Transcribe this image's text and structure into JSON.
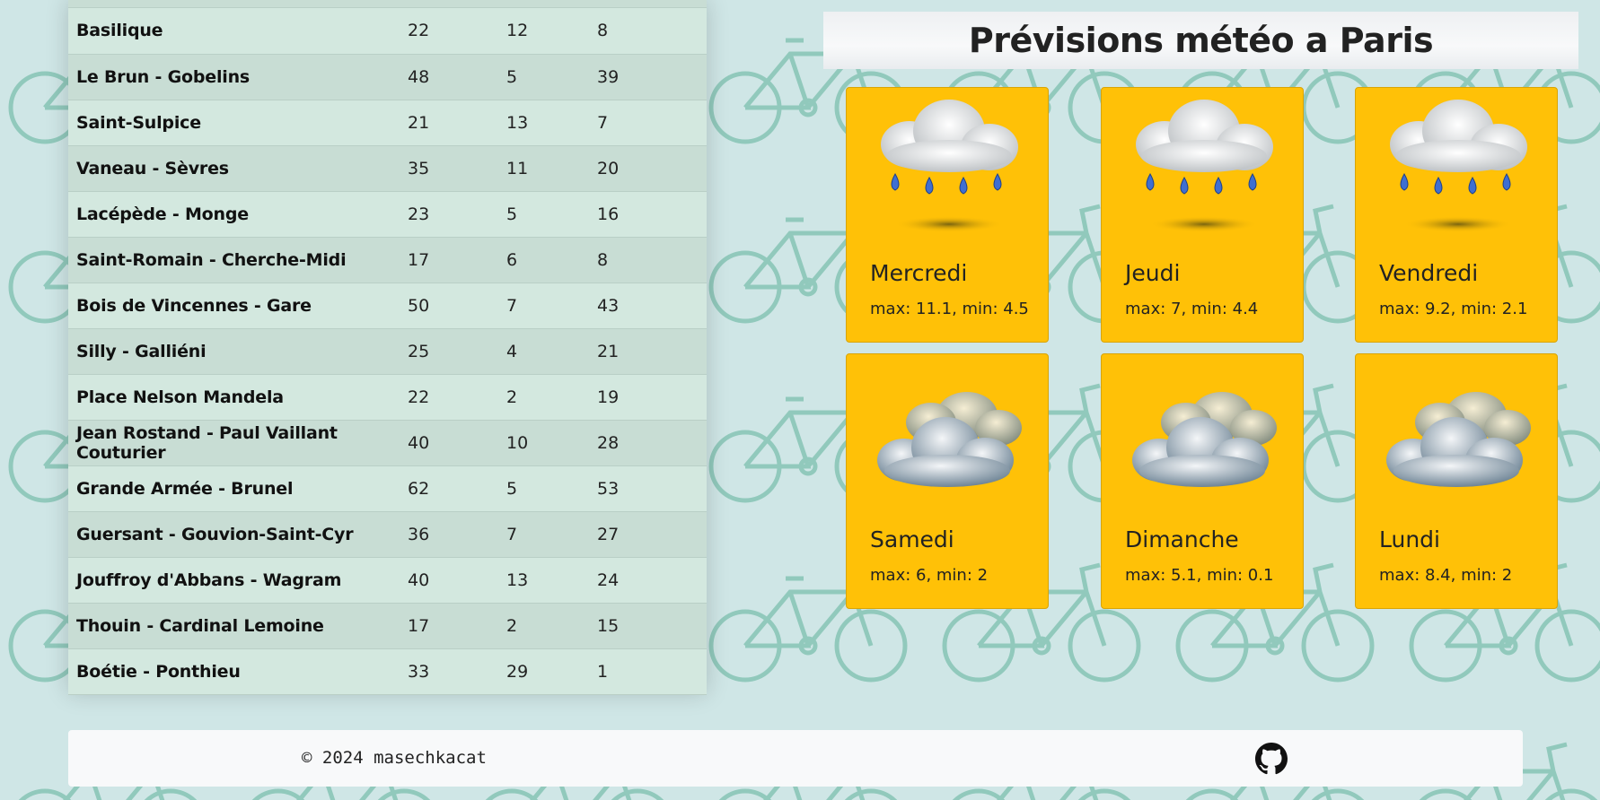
{
  "stations": {
    "rows": [
      {
        "name": "Basilique",
        "c1": "22",
        "c2": "12",
        "c3": "8"
      },
      {
        "name": "Le Brun - Gobelins",
        "c1": "48",
        "c2": "5",
        "c3": "39"
      },
      {
        "name": "Saint-Sulpice",
        "c1": "21",
        "c2": "13",
        "c3": "7"
      },
      {
        "name": "Vaneau - Sèvres",
        "c1": "35",
        "c2": "11",
        "c3": "20"
      },
      {
        "name": "Lacépède - Monge",
        "c1": "23",
        "c2": "5",
        "c3": "16"
      },
      {
        "name": "Saint-Romain - Cherche-Midi",
        "c1": "17",
        "c2": "6",
        "c3": "8"
      },
      {
        "name": "Bois de Vincennes - Gare",
        "c1": "50",
        "c2": "7",
        "c3": "43"
      },
      {
        "name": "Silly - Galliéni",
        "c1": "25",
        "c2": "4",
        "c3": "21"
      },
      {
        "name": "Place Nelson Mandela",
        "c1": "22",
        "c2": "2",
        "c3": "19"
      },
      {
        "name": "Jean Rostand - Paul Vaillant Couturier",
        "c1": "40",
        "c2": "10",
        "c3": "28"
      },
      {
        "name": "Grande Armée - Brunel",
        "c1": "62",
        "c2": "5",
        "c3": "53"
      },
      {
        "name": "Guersant - Gouvion-Saint-Cyr",
        "c1": "36",
        "c2": "7",
        "c3": "27"
      },
      {
        "name": "Jouffroy d'Abbans - Wagram",
        "c1": "40",
        "c2": "13",
        "c3": "24"
      },
      {
        "name": "Thouin - Cardinal Lemoine",
        "c1": "17",
        "c2": "2",
        "c3": "15"
      },
      {
        "name": "Boétie - Ponthieu",
        "c1": "33",
        "c2": "29",
        "c3": "1"
      }
    ]
  },
  "weather": {
    "title": "Prévisions météo a Paris",
    "cards": [
      {
        "day": "Mercredi",
        "temps": "max: 11.1, min: 4.5",
        "icon": "rain-cloud-icon"
      },
      {
        "day": "Jeudi",
        "temps": "max: 7, min: 4.4",
        "icon": "rain-cloud-icon"
      },
      {
        "day": "Vendredi",
        "temps": "max: 9.2, min: 2.1",
        "icon": "rain-cloud-icon"
      },
      {
        "day": "Samedi",
        "temps": "max: 6, min: 2",
        "icon": "clouds-icon"
      },
      {
        "day": "Dimanche",
        "temps": "max: 5.1, min: 0.1",
        "icon": "clouds-icon"
      },
      {
        "day": "Lundi",
        "temps": "max: 8.4, min: 2",
        "icon": "clouds-icon"
      }
    ]
  },
  "footer": {
    "copyright": "© 2024 masechkacat",
    "github_icon": "github-icon"
  },
  "colors": {
    "background": "#cfe6e6",
    "card": "#ffc107",
    "table_odd": "#d3e8df",
    "table_even": "#c8ddd4"
  }
}
